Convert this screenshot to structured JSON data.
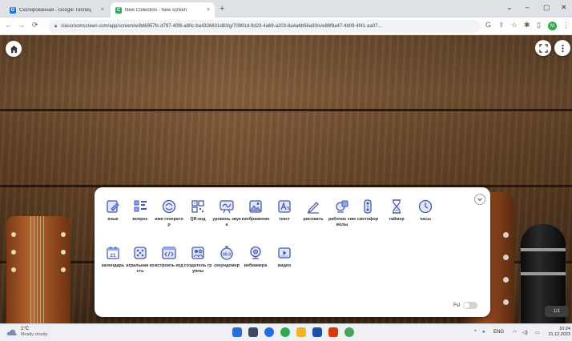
{
  "browser": {
    "tabs": [
      {
        "title": "Скопированная - Google Таблиц",
        "active": false,
        "favicon_color": "#1a73e8"
      },
      {
        "title": "New Collection - New screen",
        "active": true,
        "favicon_color": "#34a853"
      }
    ],
    "new_tab_symbol": "+",
    "close_symbol": "×",
    "address": "classroomscreen.com/app/screen/w/8d6957fc-d797-40f8-a80c-ba4326631d83/g/70991d-9d23-4a69-a203-8a4a6b56a93/s/e88f9a47-4b09-4f41-aa07...",
    "window_controls": [
      "⌄",
      "–",
      "▢",
      "✕"
    ]
  },
  "overlay": {
    "page_counter": "1/1"
  },
  "widgets": [
    {
      "label": "язык",
      "icon": "name-picker-icon",
      "color": "#4a5a9a"
    },
    {
      "label": "вопрос",
      "icon": "group-maker-icon",
      "color": "#4a5a9a"
    },
    {
      "label": "имя генератор",
      "icon": "random-name-icon",
      "color": "#4a5a9a"
    },
    {
      "label": "QR-код",
      "icon": "qr-code-icon",
      "color": "#4a5a9a"
    },
    {
      "label": "уровень звука",
      "icon": "sound-level-icon",
      "color": "#4a5a9a"
    },
    {
      "label": "изображение",
      "icon": "image-icon",
      "color": "#4a5a9a"
    },
    {
      "label": "текст",
      "icon": "text-icon",
      "color": "#4a5a9a"
    },
    {
      "label": "рисовать",
      "icon": "draw-icon",
      "color": "#4a5a9a"
    },
    {
      "label": "рабочие символы",
      "icon": "work-symbols-icon",
      "color": "#4a5a9a"
    },
    {
      "label": "светофор",
      "icon": "traffic-light-icon",
      "color": "#4a5a9a"
    },
    {
      "label": "таймер",
      "icon": "hourglass-icon",
      "color": "#4a5a9a"
    },
    {
      "label": "часы",
      "icon": "clock-icon",
      "color": "#4a5a9a"
    },
    {
      "label": "календарь",
      "icon": "calendar-icon",
      "color": "#4a5a9a",
      "day": "21"
    },
    {
      "label": "игральная кость",
      "icon": "dice-icon",
      "color": "#4a5a9a"
    },
    {
      "label": "встроить код",
      "icon": "embed-icon",
      "color": "#4a5a9a"
    },
    {
      "label": "создатель группы",
      "icon": "group-icon",
      "color": "#4a5a9a"
    },
    {
      "label": "секундомер",
      "icon": "stopwatch-icon",
      "color": "#4a5a9a"
    },
    {
      "label": "вебкамера",
      "icon": "webcam-icon",
      "color": "#4a5a9a"
    },
    {
      "label": "видео",
      "icon": "video-icon",
      "color": "#4a5a9a"
    }
  ],
  "panel": {
    "fullscreen_label": "Fsl"
  },
  "taskbar": {
    "weather_temp": "1°C",
    "weather_cond": "Mostly cloudy",
    "lang": "ENG",
    "time": "10:24",
    "date": "21.12.2023"
  }
}
